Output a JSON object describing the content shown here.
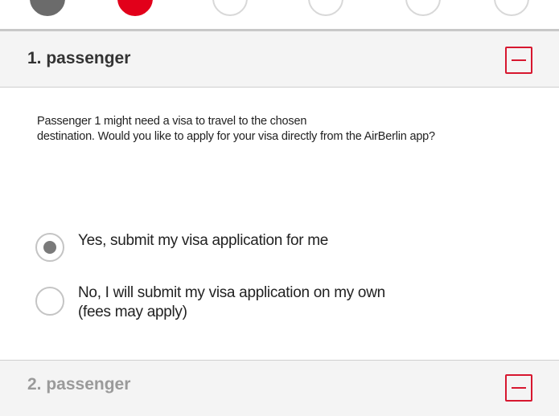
{
  "steps": [
    {
      "state": "done",
      "name": "step-1"
    },
    {
      "state": "current",
      "name": "step-2"
    },
    {
      "state": "upcoming",
      "name": "step-3"
    },
    {
      "state": "upcoming",
      "name": "step-4"
    },
    {
      "state": "upcoming",
      "name": "step-5"
    },
    {
      "state": "upcoming",
      "name": "step-6"
    }
  ],
  "passenger1": {
    "title": "1. passenger",
    "toggle_icon": "minus-icon",
    "info_line1": "Passenger 1  might need a visa to travel to the chosen",
    "info_line2": "destination. Would you like to apply for your visa directly from the AirBerlin app?",
    "options": [
      {
        "label_line1": "Yes, submit my visa application for me",
        "label_line2": "",
        "selected": true
      },
      {
        "label_line1": "No, I will submit my visa application on my own",
        "label_line2": "(fees may apply)",
        "selected": false
      }
    ]
  },
  "passenger2": {
    "title": "2. passenger",
    "toggle_icon": "minus-icon"
  },
  "colors": {
    "accent": "#e2001a",
    "header_bg": "#f4f4f4",
    "radio_dot": "#7a7a7a"
  }
}
